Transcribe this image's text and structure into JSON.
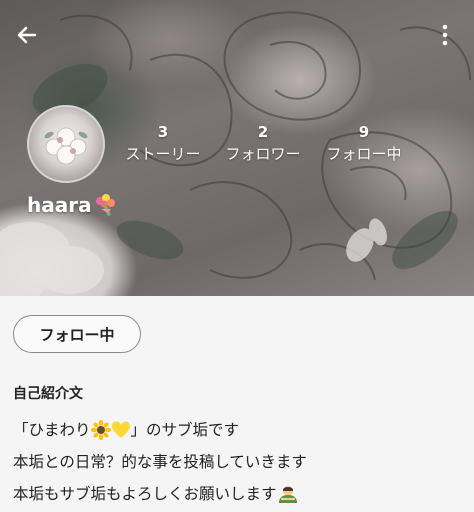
{
  "toolbar": {
    "back_icon": "arrow-left-icon",
    "more_icon": "more-vertical-icon"
  },
  "profile": {
    "avatar_icon": "flower-avatar",
    "username": "haara",
    "username_emoji": "bouquet-emoji",
    "stats": [
      {
        "count": "3",
        "label": "ストーリー"
      },
      {
        "count": "2",
        "label": "フォロワー"
      },
      {
        "count": "9",
        "label": "フォロー中"
      }
    ],
    "follow_button": "フォロー中"
  },
  "bio": {
    "title": "自己紹介文",
    "line1_a": "「ひまわり",
    "line1_b": "」のサブ垢です",
    "line1_emojis": [
      "sunflower-emoji",
      "yellow-heart-emoji"
    ],
    "line2": "本垢との日常？的な事を投稿していきます",
    "line3": "本垢もサブ垢もよろしくお願いします",
    "line3_emoji": "bowing-person-emoji"
  }
}
